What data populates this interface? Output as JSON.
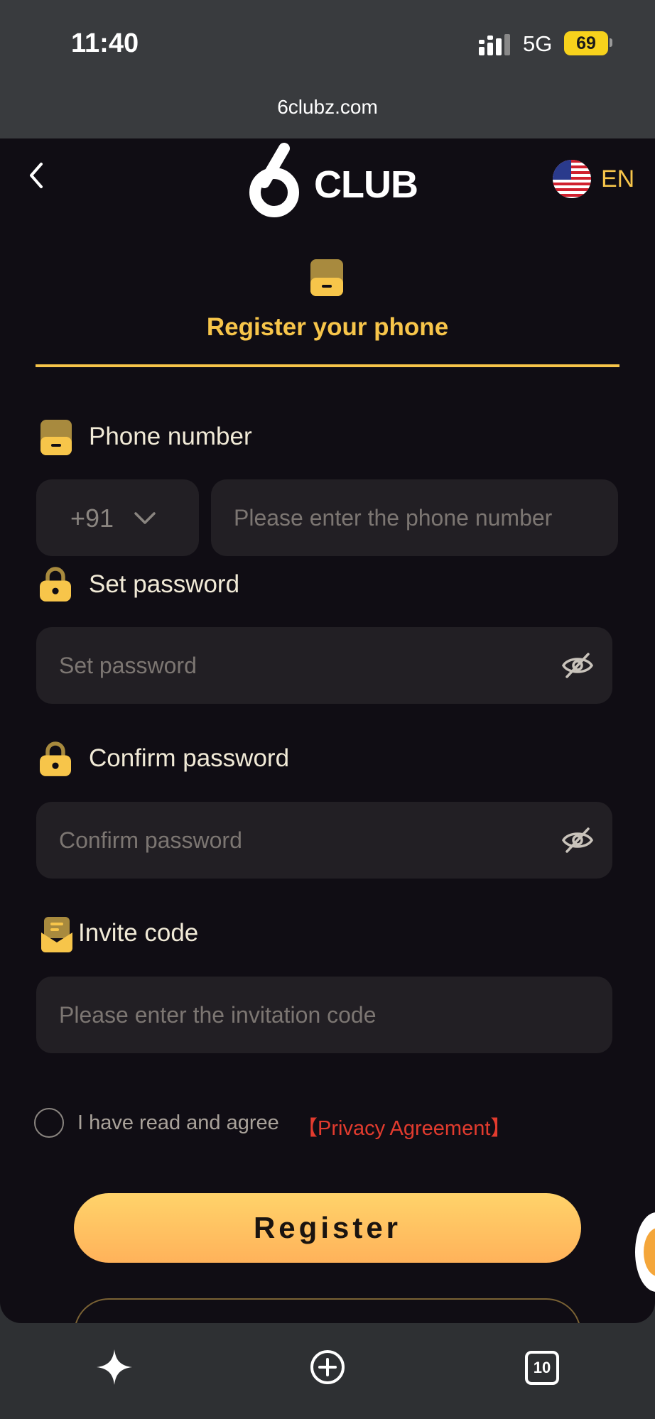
{
  "status_bar": {
    "time": "11:40",
    "network": "5G",
    "battery": "69"
  },
  "browser": {
    "url": "6clubz.com"
  },
  "header": {
    "logo_text": "CLUB",
    "language": "EN"
  },
  "tab": {
    "title": "Register your phone"
  },
  "form": {
    "phone": {
      "label": "Phone number",
      "country_code": "+91",
      "placeholder": "Please enter the phone number"
    },
    "password": {
      "label": "Set password",
      "placeholder": "Set password"
    },
    "confirm": {
      "label": "Confirm password",
      "placeholder": "Confirm password"
    },
    "invite": {
      "label": "Invite code",
      "placeholder": "Please enter the invitation code"
    },
    "agree_text": "I have read and agree",
    "privacy_link": "【Privacy Agreement】",
    "register_label": "Register"
  },
  "icons": {
    "back": "chevron-left-icon",
    "phone": "phone-icon",
    "lock": "lock-icon",
    "eye_off": "eye-off-icon",
    "invite": "invite-icon",
    "flag": "us-flag-icon",
    "sparkle": "sparkle-icon",
    "new_tab": "plus-circle-icon",
    "tabs": "tabs-icon"
  },
  "bottom_toolbar": {
    "tabs_count": "10"
  },
  "colors": {
    "accent": "#f7c54a",
    "background": "#100d14",
    "field": "#221f24",
    "link_red": "#e23b2e",
    "button_top": "#ffd36a",
    "button_bottom": "#ffb25a"
  }
}
